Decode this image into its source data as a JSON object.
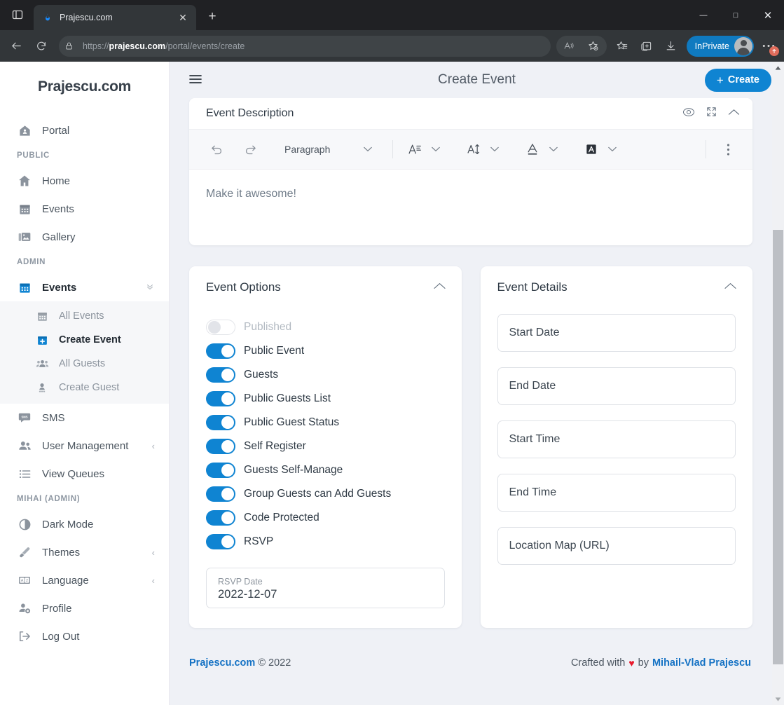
{
  "browser": {
    "tab": {
      "title": "Prajescu.com",
      "favicon": "flame-icon",
      "close": "✕"
    },
    "newtab_label": "+",
    "window_controls": {
      "minimize": "—",
      "maximize": "□",
      "close": "✕"
    },
    "omnibox": {
      "scheme": "https://",
      "domain": "prajescu.com",
      "path": "/portal/events/create",
      "lock": "lock-icon"
    },
    "toolbar_icons": [
      "read-aloud-icon",
      "add-favorite-icon",
      "favorites-icon",
      "collections-icon",
      "downloads-icon"
    ],
    "profile": {
      "label": "InPrivate"
    },
    "more_badge": "↑"
  },
  "sidebar": {
    "brand": "Prajescu.com",
    "top_items": [
      {
        "label": "Portal",
        "icon": "portal-home-icon"
      }
    ],
    "sections": [
      {
        "label": "PUBLIC",
        "items": [
          {
            "label": "Home",
            "icon": "home-icon"
          },
          {
            "label": "Events",
            "icon": "calendar-icon"
          },
          {
            "label": "Gallery",
            "icon": "gallery-icon"
          }
        ]
      },
      {
        "label": "ADMIN",
        "items": [
          {
            "label": "Events",
            "icon": "calendar-blue-icon",
            "arrow": "»",
            "expanded": true
          },
          {
            "label": "SMS",
            "icon": "sms-icon"
          },
          {
            "label": "User Management",
            "icon": "users-icon",
            "arrow": "‹"
          },
          {
            "label": "View Queues",
            "icon": "list-icon"
          }
        ]
      },
      {
        "label": "MIHAI (ADMIN)",
        "items": [
          {
            "label": "Dark Mode",
            "icon": "contrast-icon"
          },
          {
            "label": "Themes",
            "icon": "brush-icon",
            "arrow": "‹"
          },
          {
            "label": "Language",
            "icon": "translate-icon",
            "arrow": "‹"
          },
          {
            "label": "Profile",
            "icon": "profile-gear-icon"
          },
          {
            "label": "Log Out",
            "icon": "logout-icon"
          }
        ]
      }
    ],
    "sub_items": [
      {
        "label": "All Events",
        "icon": "calendar-outline-icon",
        "active": false
      },
      {
        "label": "Create Event",
        "icon": "calendar-plus-icon",
        "active": true
      },
      {
        "label": "All Guests",
        "icon": "guests-icon",
        "active": false
      },
      {
        "label": "Create Guest",
        "icon": "guest-add-icon",
        "active": false
      }
    ]
  },
  "topbar": {
    "menu_icon": "hamburger-icon",
    "title": "Create Event",
    "create_button": "Create",
    "create_plus": "+"
  },
  "editor": {
    "title": "Event Description",
    "head_icons": [
      "preview-eye-icon",
      "fullscreen-icon",
      "collapse-chevron-icon"
    ],
    "toolbar": {
      "undo": "undo-icon",
      "redo": "redo-icon",
      "block_format": "Paragraph",
      "chevron": "⌄",
      "font_size_icon": "font-size-icon",
      "line_height_icon": "line-height-icon",
      "text_color_icon": "text-color-icon",
      "highlight_icon": "highlight-color-icon",
      "overflow": "more-vertical-icon"
    },
    "placeholder": "Make it awesome!"
  },
  "event_options": {
    "title": "Event Options",
    "collapse_icon": "chevron-up-icon",
    "toggles": [
      {
        "label": "Published",
        "on": false,
        "disabled": true
      },
      {
        "label": "Public Event",
        "on": true,
        "disabled": false
      },
      {
        "label": "Guests",
        "on": true,
        "disabled": false
      },
      {
        "label": "Public Guests List",
        "on": true,
        "disabled": false
      },
      {
        "label": "Public Guest Status",
        "on": true,
        "disabled": false
      },
      {
        "label": "Self Register",
        "on": true,
        "disabled": false
      },
      {
        "label": "Guests Self-Manage",
        "on": true,
        "disabled": false
      },
      {
        "label": "Group Guests can Add Guests",
        "on": true,
        "disabled": false
      },
      {
        "label": "Code Protected",
        "on": true,
        "disabled": false
      },
      {
        "label": "RSVP",
        "on": true,
        "disabled": false
      }
    ],
    "rsvp_date": {
      "label": "RSVP Date",
      "value": "2022-12-07"
    }
  },
  "event_details": {
    "title": "Event Details",
    "collapse_icon": "chevron-up-icon",
    "fields": [
      {
        "label": "Start Date",
        "value": ""
      },
      {
        "label": "End Date",
        "value": ""
      },
      {
        "label": "Start Time",
        "value": ""
      },
      {
        "label": "End Time",
        "value": ""
      },
      {
        "label": "Location Map (URL)",
        "value": ""
      }
    ]
  },
  "footer": {
    "brand": "Prajescu.com",
    "copyright": "© 2022",
    "crafted_prefix": "Crafted with",
    "heart": "♥",
    "by": "by",
    "author": "Mihail-Vlad Prajescu"
  },
  "colors": {
    "accent": "#0f84d2",
    "link": "#1572c4",
    "heart": "#e8192c",
    "sidebar_bg": "#ffffff",
    "app_bg": "#eff1f6"
  }
}
